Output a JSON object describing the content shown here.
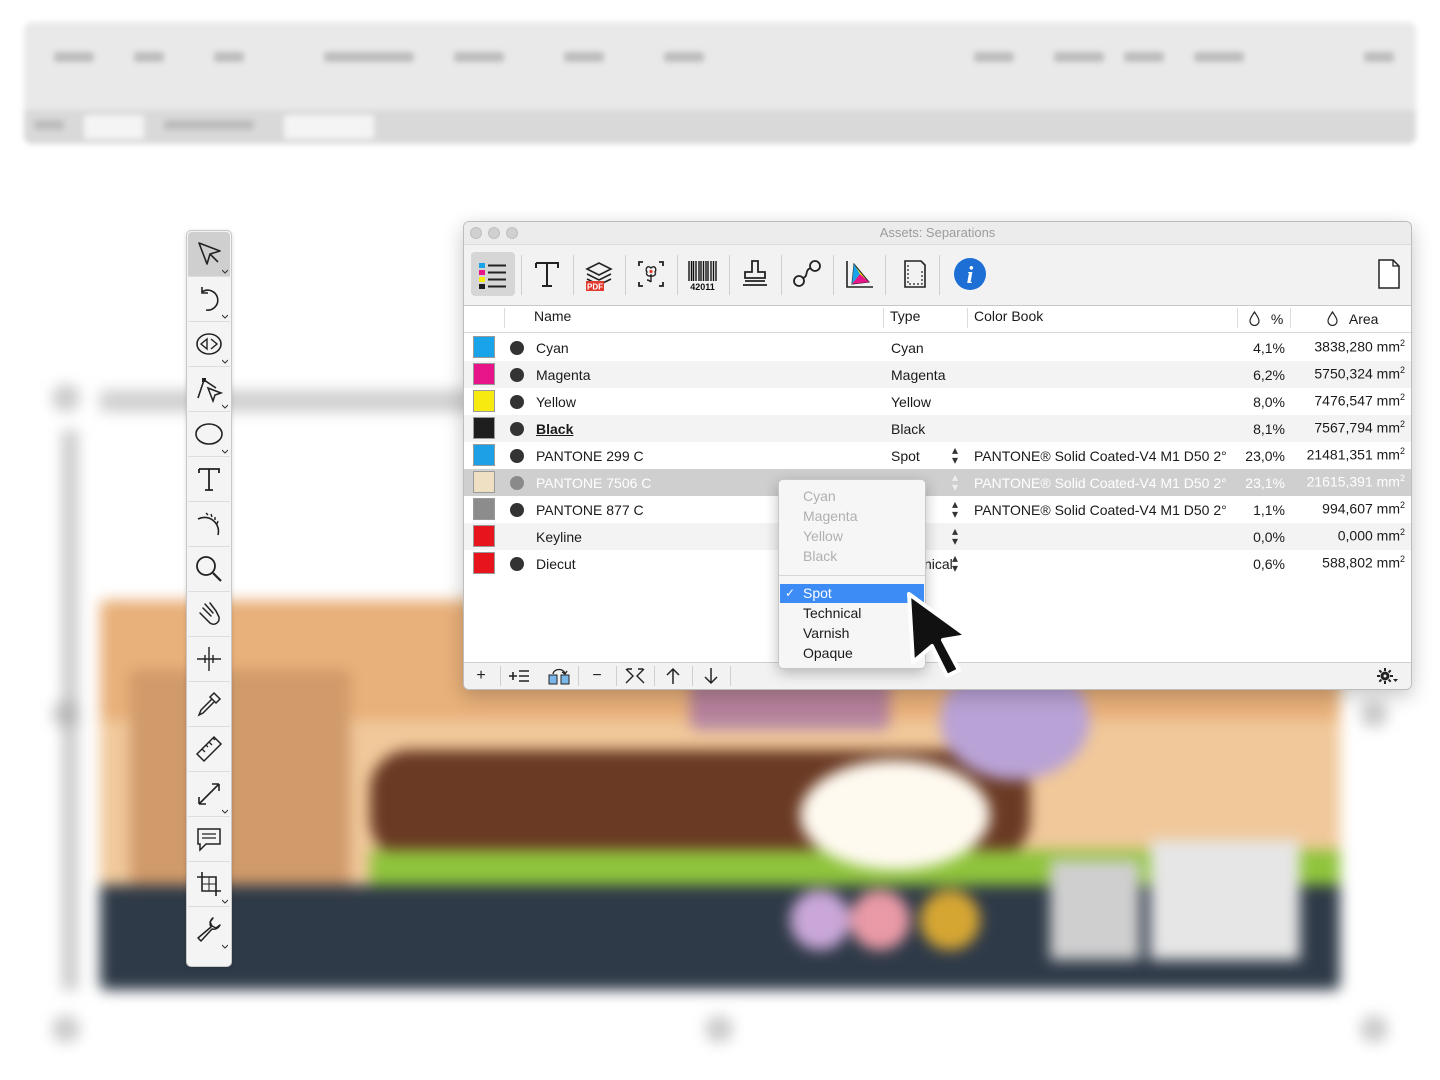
{
  "window": {
    "title": "Assets: Separations"
  },
  "toolbar": {
    "barcode_text": "42011",
    "pdf_badge": "PDF",
    "info_glyph": "i"
  },
  "columns": {
    "name": "Name",
    "type": "Type",
    "color_book": "Color Book",
    "percent": "%",
    "area": "Area"
  },
  "separations": [
    {
      "name": "Cyan",
      "type": "Cyan",
      "book": "",
      "pct": "4,1%",
      "area": "3838,280 mm",
      "swatch": "#19a3e8",
      "dot": true,
      "bold": false
    },
    {
      "name": "Magenta",
      "type": "Magenta",
      "book": "",
      "pct": "6,2%",
      "area": "5750,324 mm",
      "swatch": "#e8158a",
      "dot": true,
      "bold": false
    },
    {
      "name": "Yellow",
      "type": "Yellow",
      "book": "",
      "pct": "8,0%",
      "area": "7476,547 mm",
      "swatch": "#f7ea10",
      "dot": true,
      "bold": false
    },
    {
      "name": "Black",
      "type": "Black",
      "book": "",
      "pct": "8,1%",
      "area": "7567,794 mm",
      "swatch": "#1e1e1e",
      "dot": true,
      "bold": true
    },
    {
      "name": "PANTONE 299 C",
      "type": "Spot",
      "book": "PANTONE® Solid Coated-V4 M1 D50 2°",
      "pct": "23,0%",
      "area": "21481,351 mm",
      "swatch": "#1ea0e6",
      "dot": true,
      "bold": false
    },
    {
      "name": "PANTONE 7506 C",
      "type": "Spot",
      "book": "PANTONE® Solid Coated-V4 M1 D50 2°",
      "pct": "23,1%",
      "area": "21615,391 mm",
      "swatch": "#efdfc3",
      "dot": true,
      "bold": false
    },
    {
      "name": "PANTONE 877 C",
      "type": "Spot",
      "book": "PANTONE® Solid Coated-V4 M1 D50 2°",
      "pct": "1,1%",
      "area": "994,607 mm",
      "swatch": "#8c8c8c",
      "dot": true,
      "bold": false
    },
    {
      "name": "Keyline",
      "type": "Technical",
      "book": "",
      "pct": "0,0%",
      "area": "0,000 mm",
      "swatch": "#e8141c",
      "dot": false,
      "bold": false
    },
    {
      "name": "Diecut",
      "type": "Technical",
      "book": "",
      "pct": "0,6%",
      "area": "588,802 mm",
      "swatch": "#e8141c",
      "dot": true,
      "bold": false
    }
  ],
  "visible_type_fragment": "nical",
  "area_superscript": "2",
  "type_menu": {
    "disabled": [
      "Cyan",
      "Magenta",
      "Yellow",
      "Black"
    ],
    "selected": "Spot",
    "check": "✓",
    "options": [
      "Technical",
      "Varnish",
      "Opaque"
    ]
  },
  "bottom_toolbar": {
    "add": "+",
    "remove": "−"
  },
  "colors": {
    "selection_blue": "#3d8cf5",
    "selected_row": "#cfcfcf",
    "info_blue": "#1d6fd6"
  }
}
